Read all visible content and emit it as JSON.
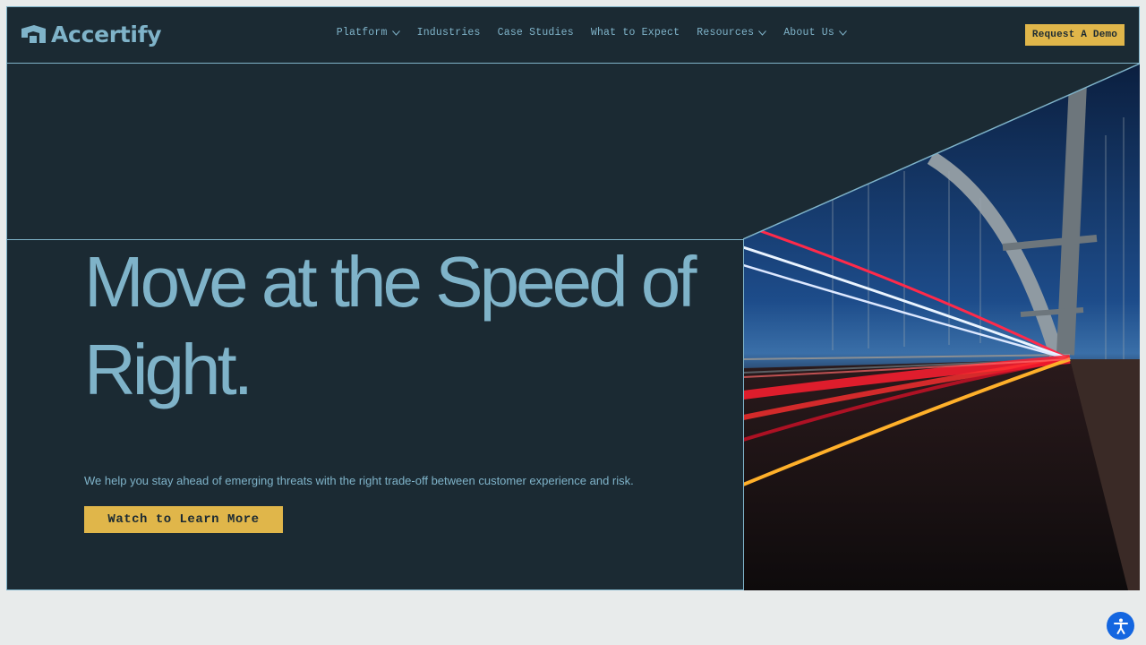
{
  "brand": {
    "name": "Accertify"
  },
  "nav": {
    "items": [
      {
        "label": "Platform",
        "dropdown": true
      },
      {
        "label": "Industries",
        "dropdown": false
      },
      {
        "label": "Case Studies",
        "dropdown": false
      },
      {
        "label": "What to Expect",
        "dropdown": false
      },
      {
        "label": "Resources",
        "dropdown": true
      },
      {
        "label": "About Us",
        "dropdown": true
      }
    ],
    "cta_label": "Request A Demo"
  },
  "hero": {
    "headline_line1": "Move at the Speed of",
    "headline_line2": "Right.",
    "subtext": "We help you stay ahead of emerging threats with the right trade-off between customer experience and risk.",
    "cta_label": "Watch to Learn More",
    "image_icon": "bridge-light-trails-image"
  },
  "accessibility": {
    "icon": "accessibility-icon"
  },
  "colors": {
    "background_dark": "#1b2a33",
    "accent_blue": "#7fb3c9",
    "accent_yellow": "#e0b64a",
    "page_light": "#e8ebeb",
    "a11y_blue": "#1466e0"
  }
}
